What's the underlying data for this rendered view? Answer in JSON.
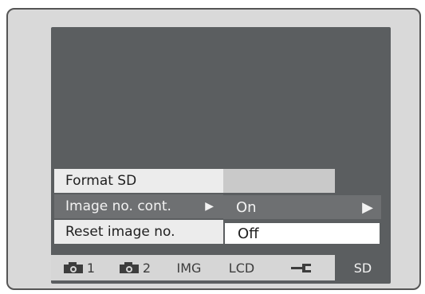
{
  "menu": {
    "items": [
      {
        "label": "Format SD",
        "selected": false,
        "has_submenu": false
      },
      {
        "label": "Image no. cont.",
        "selected": true,
        "has_submenu": true
      },
      {
        "label": "Reset image no.",
        "selected": false,
        "has_submenu": false
      }
    ]
  },
  "submenu": {
    "options": [
      {
        "label": "On",
        "selected": true
      },
      {
        "label": "Off",
        "selected": false
      }
    ]
  },
  "tabs": [
    {
      "label": "1",
      "icon": "camera-icon",
      "active": false
    },
    {
      "label": "2",
      "icon": "camera-icon",
      "active": false
    },
    {
      "label": "IMG",
      "active": false
    },
    {
      "label": "LCD",
      "active": false
    },
    {
      "label": "",
      "icon": "wrench-icon",
      "active": false
    },
    {
      "label": "SD",
      "active": true
    }
  ],
  "colors": {
    "screen": "#5b5e60",
    "menu_light": "#ececec",
    "menu_selected": "#6e7072",
    "tabbar": "#d6d6d6"
  }
}
